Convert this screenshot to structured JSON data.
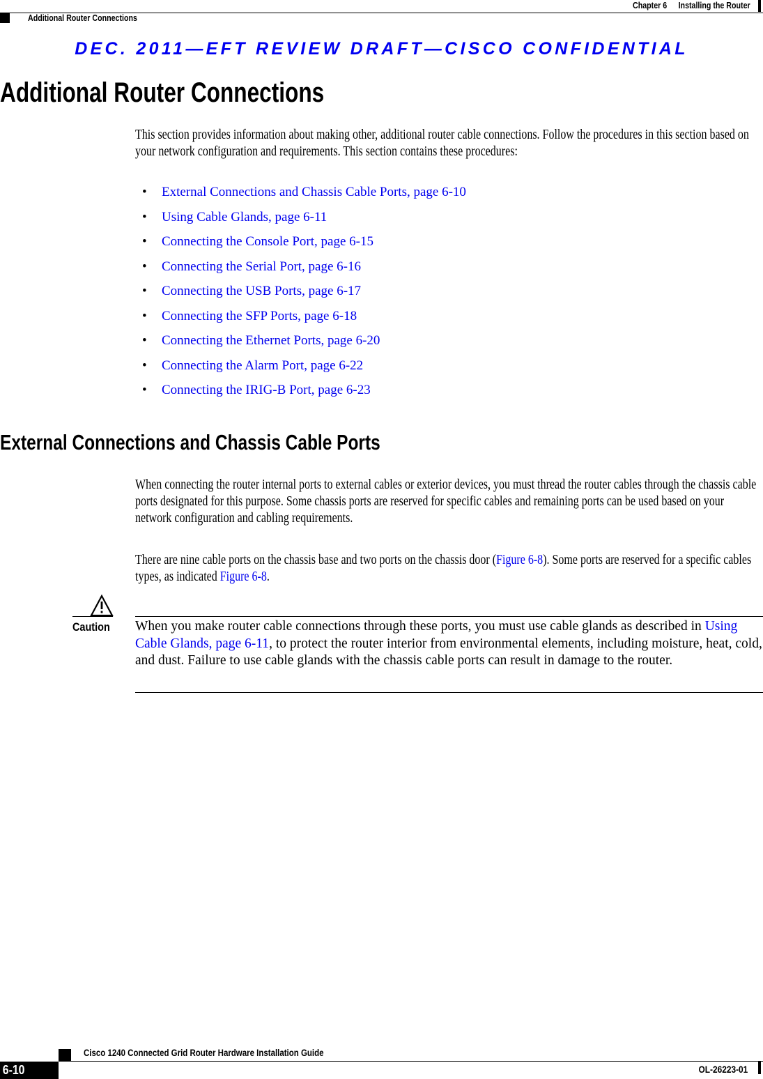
{
  "header": {
    "chapter_label": "Chapter 6",
    "chapter_title": "Installing the Router",
    "section_label": "Additional Router Connections"
  },
  "banner": {
    "text": "DEC. 2011—EFT REVIEW DRAFT—CISCO CONFIDENTIAL",
    "color": "#0000f0"
  },
  "main": {
    "title": "Additional Router Connections",
    "intro": "This section provides information about making other, additional router cable connections. Follow the procedures in this section based on your network configuration and requirements. This section contains these procedures:",
    "procedures": [
      {
        "label": "External Connections and Chassis Cable Ports, page 6-10"
      },
      {
        "label": "Using Cable Glands, page 6-11"
      },
      {
        "label": "Connecting the Console Port, page 6-15"
      },
      {
        "label": "Connecting the Serial Port, page 6-16"
      },
      {
        "label": "Connecting the USB Ports, page 6-17"
      },
      {
        "label": "Connecting the SFP Ports, page 6-18"
      },
      {
        "label": "Connecting the Ethernet Ports, page 6-20"
      },
      {
        "label": "Connecting the Alarm Port, page 6-22"
      },
      {
        "label": "Connecting the IRIG-B Port, page 6-23"
      }
    ],
    "bullet_glyph": "•",
    "link_color": "#0000ee"
  },
  "external_section": {
    "title": "External Connections and Chassis Cable Ports",
    "para1": "When connecting the router internal ports to external cables or exterior devices, you must thread the router cables through the chassis cable ports designated for this purpose. Some chassis ports are reserved for specific cables and remaining ports can be used based on your network configuration and cabling requirements.",
    "para2_part1": "There are nine cable ports on the chassis base and two ports on the chassis door (",
    "para2_link1": "Figure 6-8",
    "para2_part2": "). Some ports are reserved for a specific cables types, as indicated ",
    "para2_link2": "Figure 6-8",
    "para2_part3": "."
  },
  "caution": {
    "icon": "warning-triangle-icon",
    "label": "Caution",
    "text_part1": "When you make router cable connections through these ports, you must use cable glands as described in ",
    "text_link": "Using Cable Glands, page 6-11",
    "text_part2": ", to protect the router interior from environmental elements, including moisture, heat, cold, and dust. Failure to use cable glands with the chassis cable ports can result in damage to the router."
  },
  "footer": {
    "guide_title": "Cisco 1240 Connected Grid Router Hardware Installation Guide",
    "page_number": "6-10",
    "doc_number": "OL-26223-01"
  }
}
